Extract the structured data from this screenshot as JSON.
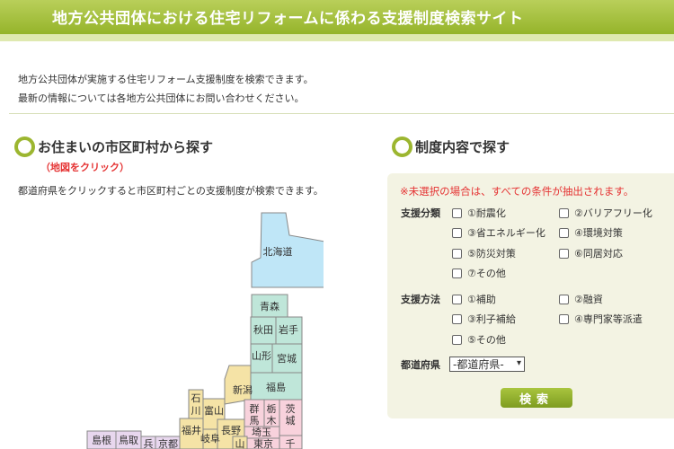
{
  "header": {
    "title": "地方公共団体における住宅リフォームに係わる支援制度検索サイト"
  },
  "intro": {
    "line1": "地方公共団体が実施する住宅リフォーム支援制度を検索できます。",
    "line2": "最新の情報については各地方公共団体にお問い合わせください。"
  },
  "map_section": {
    "title": "お住まいの市区町村から探す",
    "note": "（地図をクリック）",
    "desc": "都道府県をクリックすると市区町村ごとの支援制度が検索できます。",
    "prefectures": {
      "hokkaido": "北海道",
      "aomori": "青森",
      "akita": "秋田",
      "iwate": "岩手",
      "yamagata": "山形",
      "miyagi": "宮城",
      "fukushima": "福島",
      "niigata": "新潟",
      "ishikawa": "石川",
      "toyama": "富山",
      "gunma": "群馬",
      "tochigi": "栃木",
      "ibaraki": "茨城",
      "fukui": "福井",
      "nagano": "長野",
      "saitama": "埼玉",
      "gifu": "岐阜",
      "shimane": "島根",
      "tottori": "鳥取",
      "hyogo": "兵",
      "kyoto": "京都",
      "yamanashi": "山",
      "tokyo": "東京",
      "chiba": "千"
    }
  },
  "search_section": {
    "title": "制度内容で探す",
    "note": "※未選択の場合は、すべての条件が抽出されます。",
    "category_label": "支援分類",
    "categories": [
      "①耐震化",
      "②バリアフリー化",
      "③省エネルギー化",
      "④環境対策",
      "⑤防災対策",
      "⑥同居対応",
      "⑦その他"
    ],
    "method_label": "支援方法",
    "methods": [
      "①補助",
      "②融資",
      "③利子補給",
      "④専門家等派遣",
      "⑤その他"
    ],
    "pref_label": "都道府県",
    "pref_select": "-都道府県-",
    "search_button": "検索"
  },
  "colors": {
    "accent": "#9cb630",
    "hokkaido": "#bfe6f7",
    "tohoku": "#bfe6d9",
    "chubu": "#f5e3a6",
    "kanto": "#f8d2dc",
    "chugoku": "#e8d7ee"
  }
}
